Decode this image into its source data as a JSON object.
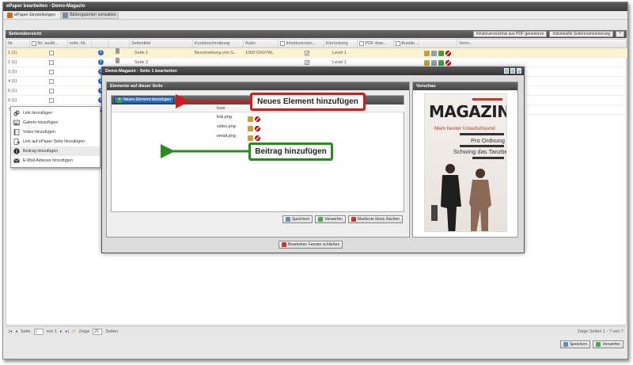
{
  "app": {
    "title": "ePaper bearbeiten - Demo-Magazin"
  },
  "tabs": [
    {
      "label": "ePaper Einstellungen",
      "icon": "settings-icon"
    },
    {
      "label": "Bildergalerien verwalten",
      "icon": "gallery-icon"
    }
  ],
  "overview": {
    "title": "Seitenübersicht",
    "buttons": [
      "Inhaltsverzeichnis aus PDF generieren",
      "Individuelle Seitennummerierung"
    ],
    "columns": [
      "Nr.",
      "Nr. ausbl...",
      "indiv. Nr.",
      "",
      "",
      "Seitentitel",
      "Kurzbeschreibung",
      "Autor",
      "Inhaltsverzeic...",
      "Einrückung",
      "PDF dow...",
      "Ausble...",
      "",
      "Verm..."
    ],
    "rows": [
      {
        "nr": "1 (1)",
        "title": "Seite 1",
        "desc": "Beschreibung von S...",
        "author": "1000°DIGITAL",
        "toc": true,
        "indent": "Level 1"
      },
      {
        "nr": "2 (1)",
        "title": "Seite 2",
        "desc": "",
        "author": "",
        "toc": true,
        "indent": "Level 1"
      },
      {
        "nr": "3 (1)"
      },
      {
        "nr": "4 (1)"
      },
      {
        "nr": "5 (1)"
      },
      {
        "nr": "6 (1)"
      },
      {
        "nr": "7 (1)"
      }
    ]
  },
  "pager": {
    "seite": "Seite",
    "page": "1",
    "von": "von 1",
    "zeige": "Zeige",
    "per_page": "25",
    "seiten": "Seiten",
    "summary": "Zeige Seiten 1 - 7 von 7"
  },
  "footer": {
    "save": "Speichern",
    "discard": "Verwerfen"
  },
  "modal": {
    "title": "Demo-Magazin - Seite 1 bearbeiten",
    "left_title": "Elemente auf dieser Seite",
    "right_title": "Vorschau",
    "new_element": "Neues Element hinzufügen",
    "col_icon": "Icon",
    "rows": [
      {
        "icon": "link.png"
      },
      {
        "icon": "video.png"
      },
      {
        "icon": "email.png"
      }
    ],
    "menu": [
      {
        "label": "Link hinzufügen",
        "icon": "link-icon"
      },
      {
        "label": "Galerie hinzufügen",
        "icon": "gallery-icon"
      },
      {
        "label": "Video hinzufügen",
        "icon": "video-icon"
      },
      {
        "label": "Link auf ePaper Seite hinzufügen",
        "icon": "page-link-icon"
      },
      {
        "label": "Beitrag hinzufügen",
        "icon": "info-icon"
      },
      {
        "label": "E-Mail Adresse hinzufügen",
        "icon": "email-icon"
      }
    ],
    "save": "Speichern",
    "discard": "Verwerfen",
    "delete_marked": "Markierte Items löschen",
    "close": "Bearbeiten Fenster schließen"
  },
  "preview": {
    "magazine": "MAGAZINE",
    "line1": "Mein bester Urlaubsfreund",
    "line2": "Pro Ordnung",
    "line3": "Schwing das Tanzbein"
  },
  "callouts": {
    "new_element": "Neues Element hinzufügen",
    "article": "Beitrag hinzufügen"
  },
  "colors": {
    "callout_red": "#d11b1b",
    "callout_green": "#2c8a22",
    "accent_blue": "#2a6bd1"
  }
}
